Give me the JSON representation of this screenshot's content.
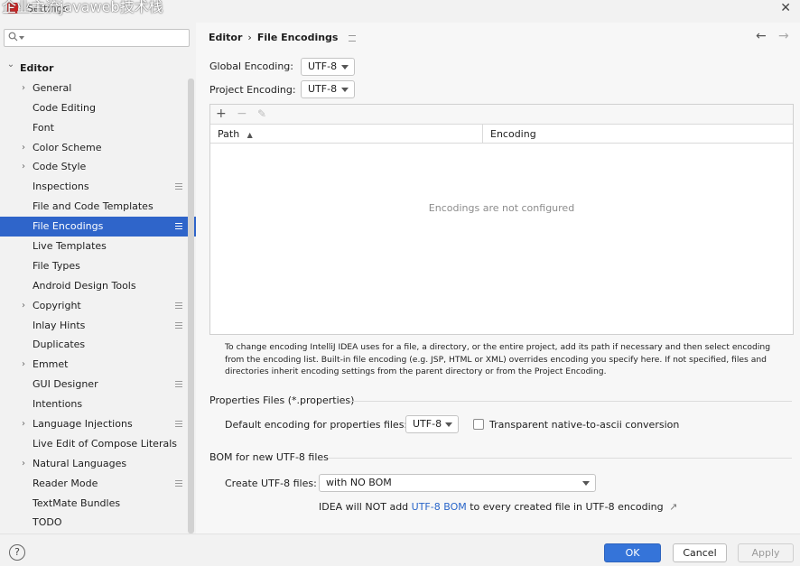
{
  "window": {
    "title": "Settings",
    "overlay_text": "企业主流javaweb技术栈",
    "close_glyph": "✕"
  },
  "sidebar": {
    "search_placeholder": "Q▾",
    "items": [
      {
        "label": "Editor",
        "level": 0,
        "expandable": true,
        "expanded": true,
        "bold": true,
        "gear": false,
        "selected": false
      },
      {
        "label": "General",
        "level": 1,
        "expandable": true,
        "expanded": false,
        "bold": false,
        "gear": false,
        "selected": false
      },
      {
        "label": "Code Editing",
        "level": 1,
        "expandable": false,
        "bold": false,
        "gear": false,
        "selected": false
      },
      {
        "label": "Font",
        "level": 1,
        "expandable": false,
        "bold": false,
        "gear": false,
        "selected": false
      },
      {
        "label": "Color Scheme",
        "level": 1,
        "expandable": true,
        "expanded": false,
        "bold": false,
        "gear": false,
        "selected": false
      },
      {
        "label": "Code Style",
        "level": 1,
        "expandable": true,
        "expanded": false,
        "bold": false,
        "gear": false,
        "selected": false
      },
      {
        "label": "Inspections",
        "level": 1,
        "expandable": false,
        "bold": false,
        "gear": true,
        "selected": false
      },
      {
        "label": "File and Code Templates",
        "level": 1,
        "expandable": false,
        "bold": false,
        "gear": false,
        "selected": false
      },
      {
        "label": "File Encodings",
        "level": 1,
        "expandable": false,
        "bold": false,
        "gear": true,
        "selected": true
      },
      {
        "label": "Live Templates",
        "level": 1,
        "expandable": false,
        "bold": false,
        "gear": false,
        "selected": false
      },
      {
        "label": "File Types",
        "level": 1,
        "expandable": false,
        "bold": false,
        "gear": false,
        "selected": false
      },
      {
        "label": "Android Design Tools",
        "level": 1,
        "expandable": false,
        "bold": false,
        "gear": false,
        "selected": false
      },
      {
        "label": "Copyright",
        "level": 1,
        "expandable": true,
        "expanded": false,
        "bold": false,
        "gear": true,
        "selected": false
      },
      {
        "label": "Inlay Hints",
        "level": 1,
        "expandable": false,
        "bold": false,
        "gear": true,
        "selected": false
      },
      {
        "label": "Duplicates",
        "level": 1,
        "expandable": false,
        "bold": false,
        "gear": false,
        "selected": false
      },
      {
        "label": "Emmet",
        "level": 1,
        "expandable": true,
        "expanded": false,
        "bold": false,
        "gear": false,
        "selected": false
      },
      {
        "label": "GUI Designer",
        "level": 1,
        "expandable": false,
        "bold": false,
        "gear": true,
        "selected": false
      },
      {
        "label": "Intentions",
        "level": 1,
        "expandable": false,
        "bold": false,
        "gear": false,
        "selected": false
      },
      {
        "label": "Language Injections",
        "level": 1,
        "expandable": true,
        "expanded": false,
        "bold": false,
        "gear": true,
        "selected": false
      },
      {
        "label": "Live Edit of Compose Literals",
        "level": 1,
        "expandable": false,
        "bold": false,
        "gear": false,
        "selected": false
      },
      {
        "label": "Natural Languages",
        "level": 1,
        "expandable": true,
        "expanded": false,
        "bold": false,
        "gear": false,
        "selected": false
      },
      {
        "label": "Reader Mode",
        "level": 1,
        "expandable": false,
        "bold": false,
        "gear": true,
        "selected": false
      },
      {
        "label": "TextMate Bundles",
        "level": 1,
        "expandable": false,
        "bold": false,
        "gear": false,
        "selected": false
      },
      {
        "label": "TODO",
        "level": 1,
        "expandable": false,
        "bold": false,
        "gear": false,
        "selected": false
      }
    ]
  },
  "breadcrumb": {
    "parent": "Editor",
    "separator": "›",
    "current": "File Encodings",
    "back_glyph": "←",
    "forward_glyph": "→"
  },
  "encodings": {
    "global_label": "Global Encoding:",
    "global_value": "UTF-8",
    "project_label": "Project Encoding:",
    "project_value": "UTF-8"
  },
  "table": {
    "add_glyph": "+",
    "remove_glyph": "−",
    "edit_glyph": "✎",
    "col_path": "Path",
    "sort_glyph": "▲",
    "col_encoding": "Encoding",
    "empty_text": "Encodings are not configured"
  },
  "hint_text": "To change encoding IntelliJ IDEA uses for a file, a directory, or the entire project, add its path if necessary and then select encoding from the encoding list. Built-in file encoding (e.g. JSP, HTML or XML) overrides encoding you specify here. If not specified, files and directories inherit encoding settings from the parent directory or from the Project Encoding.",
  "properties": {
    "section_title": "Properties Files (*.properties)",
    "default_label": "Default encoding for properties files:",
    "default_value": "UTF-8",
    "transparent_label": "Transparent native-to-ascii conversion",
    "transparent_checked": false
  },
  "bom": {
    "section_title": "BOM for new UTF-8 files",
    "create_label": "Create UTF-8 files:",
    "create_value": "with NO BOM",
    "info_prefix": "IDEA will NOT add ",
    "info_link": "UTF-8 BOM",
    "info_suffix": " to every created file in UTF-8 encoding",
    "info_ext_glyph": "↗"
  },
  "footer": {
    "help_glyph": "?",
    "ok_label": "OK",
    "cancel_label": "Cancel",
    "apply_label": "Apply"
  },
  "colors": {
    "selection": "#2f65ca",
    "primary_button": "#3574d9",
    "link": "#2a66c9"
  }
}
